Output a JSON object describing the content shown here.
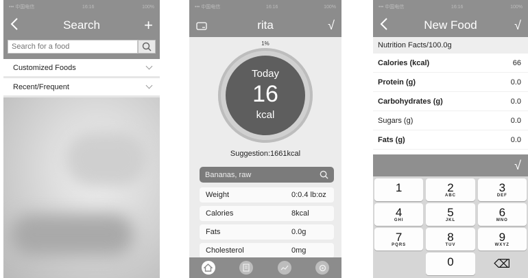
{
  "screen1": {
    "statusbar": {
      "carrier": "••• 中国电信",
      "time": "16:16",
      "battery": "100%"
    },
    "nav": {
      "back_icon": "chevron-left-icon",
      "title": "Search",
      "add_label": "+"
    },
    "search": {
      "placeholder": "Search for a food",
      "value": ""
    },
    "rows": [
      {
        "label": "Customized Foods"
      },
      {
        "label": "Recent/Frequent"
      }
    ]
  },
  "screen2": {
    "statusbar": {
      "carrier": "••• 中国电信",
      "time": "16:16",
      "battery": "100%"
    },
    "nav": {
      "title": "rita",
      "confirm": "√"
    },
    "percent": "1%",
    "circle": {
      "label": "Today",
      "value": "16",
      "unit": "kcal"
    },
    "suggestion": "Suggestion:1661kcal",
    "food_name": "Bananas, raw",
    "nutrients": [
      {
        "label": "Weight",
        "value": "0:0.4 lb:oz"
      },
      {
        "label": "Calories",
        "value": "8kcal"
      },
      {
        "label": "Fats",
        "value": "0.0g"
      },
      {
        "label": "Cholesterol",
        "value": "0mg"
      }
    ],
    "tabs": [
      "home-icon",
      "list-icon",
      "chart-icon",
      "settings-icon"
    ]
  },
  "screen3": {
    "statusbar": {
      "carrier": "••• 中国电信",
      "time": "16:16",
      "battery": "100%"
    },
    "nav": {
      "title": "New Food",
      "confirm": "√"
    },
    "facts_header": "Nutrition Facts/100.0g",
    "facts": [
      {
        "label": "Calories (kcal)",
        "value": "66",
        "bold": true
      },
      {
        "label": "Protein (g)",
        "value": "0.0",
        "bold": true
      },
      {
        "label": "Carbohydrates (g)",
        "value": "0.0",
        "bold": true
      },
      {
        "label": "Sugars (g)",
        "value": "0.0",
        "bold": false
      },
      {
        "label": "Fats (g)",
        "value": "0.0",
        "bold": true
      }
    ],
    "keyboard_done": "√",
    "keys": [
      [
        {
          "d": "1",
          "l": ""
        },
        {
          "d": "2",
          "l": "ABC"
        },
        {
          "d": "3",
          "l": "DEF"
        }
      ],
      [
        {
          "d": "4",
          "l": "GHI"
        },
        {
          "d": "5",
          "l": "JKL"
        },
        {
          "d": "6",
          "l": "MNO"
        }
      ],
      [
        {
          "d": "7",
          "l": "PQRS"
        },
        {
          "d": "8",
          "l": "TUV"
        },
        {
          "d": "9",
          "l": "WXYZ"
        }
      ],
      [
        {
          "d": "",
          "l": ""
        },
        {
          "d": "0",
          "l": ""
        },
        {
          "d": "⌫",
          "l": ""
        }
      ]
    ]
  }
}
